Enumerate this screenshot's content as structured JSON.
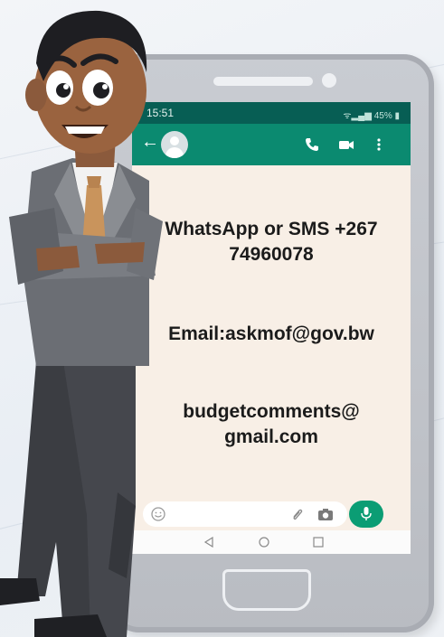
{
  "status_bar": {
    "time": "15:51",
    "battery": "45%"
  },
  "chat_header": {
    "back_icon": "arrow-left",
    "call_icon": "phone",
    "video_icon": "video-camera",
    "menu_icon": "more-vertical"
  },
  "messages": {
    "whatsapp_line1": "WhatsApp or SMS +267",
    "whatsapp_line2": "74960078",
    "email": "Email:askmof@gov.bw",
    "comments_line1": "budgetcomments@",
    "comments_line2": "gmail.com"
  },
  "colors": {
    "whatsapp_dark": "#075e54",
    "whatsapp_green": "#0b8a70",
    "chat_background": "#f8efe6",
    "mic_green": "#0b9d74"
  }
}
